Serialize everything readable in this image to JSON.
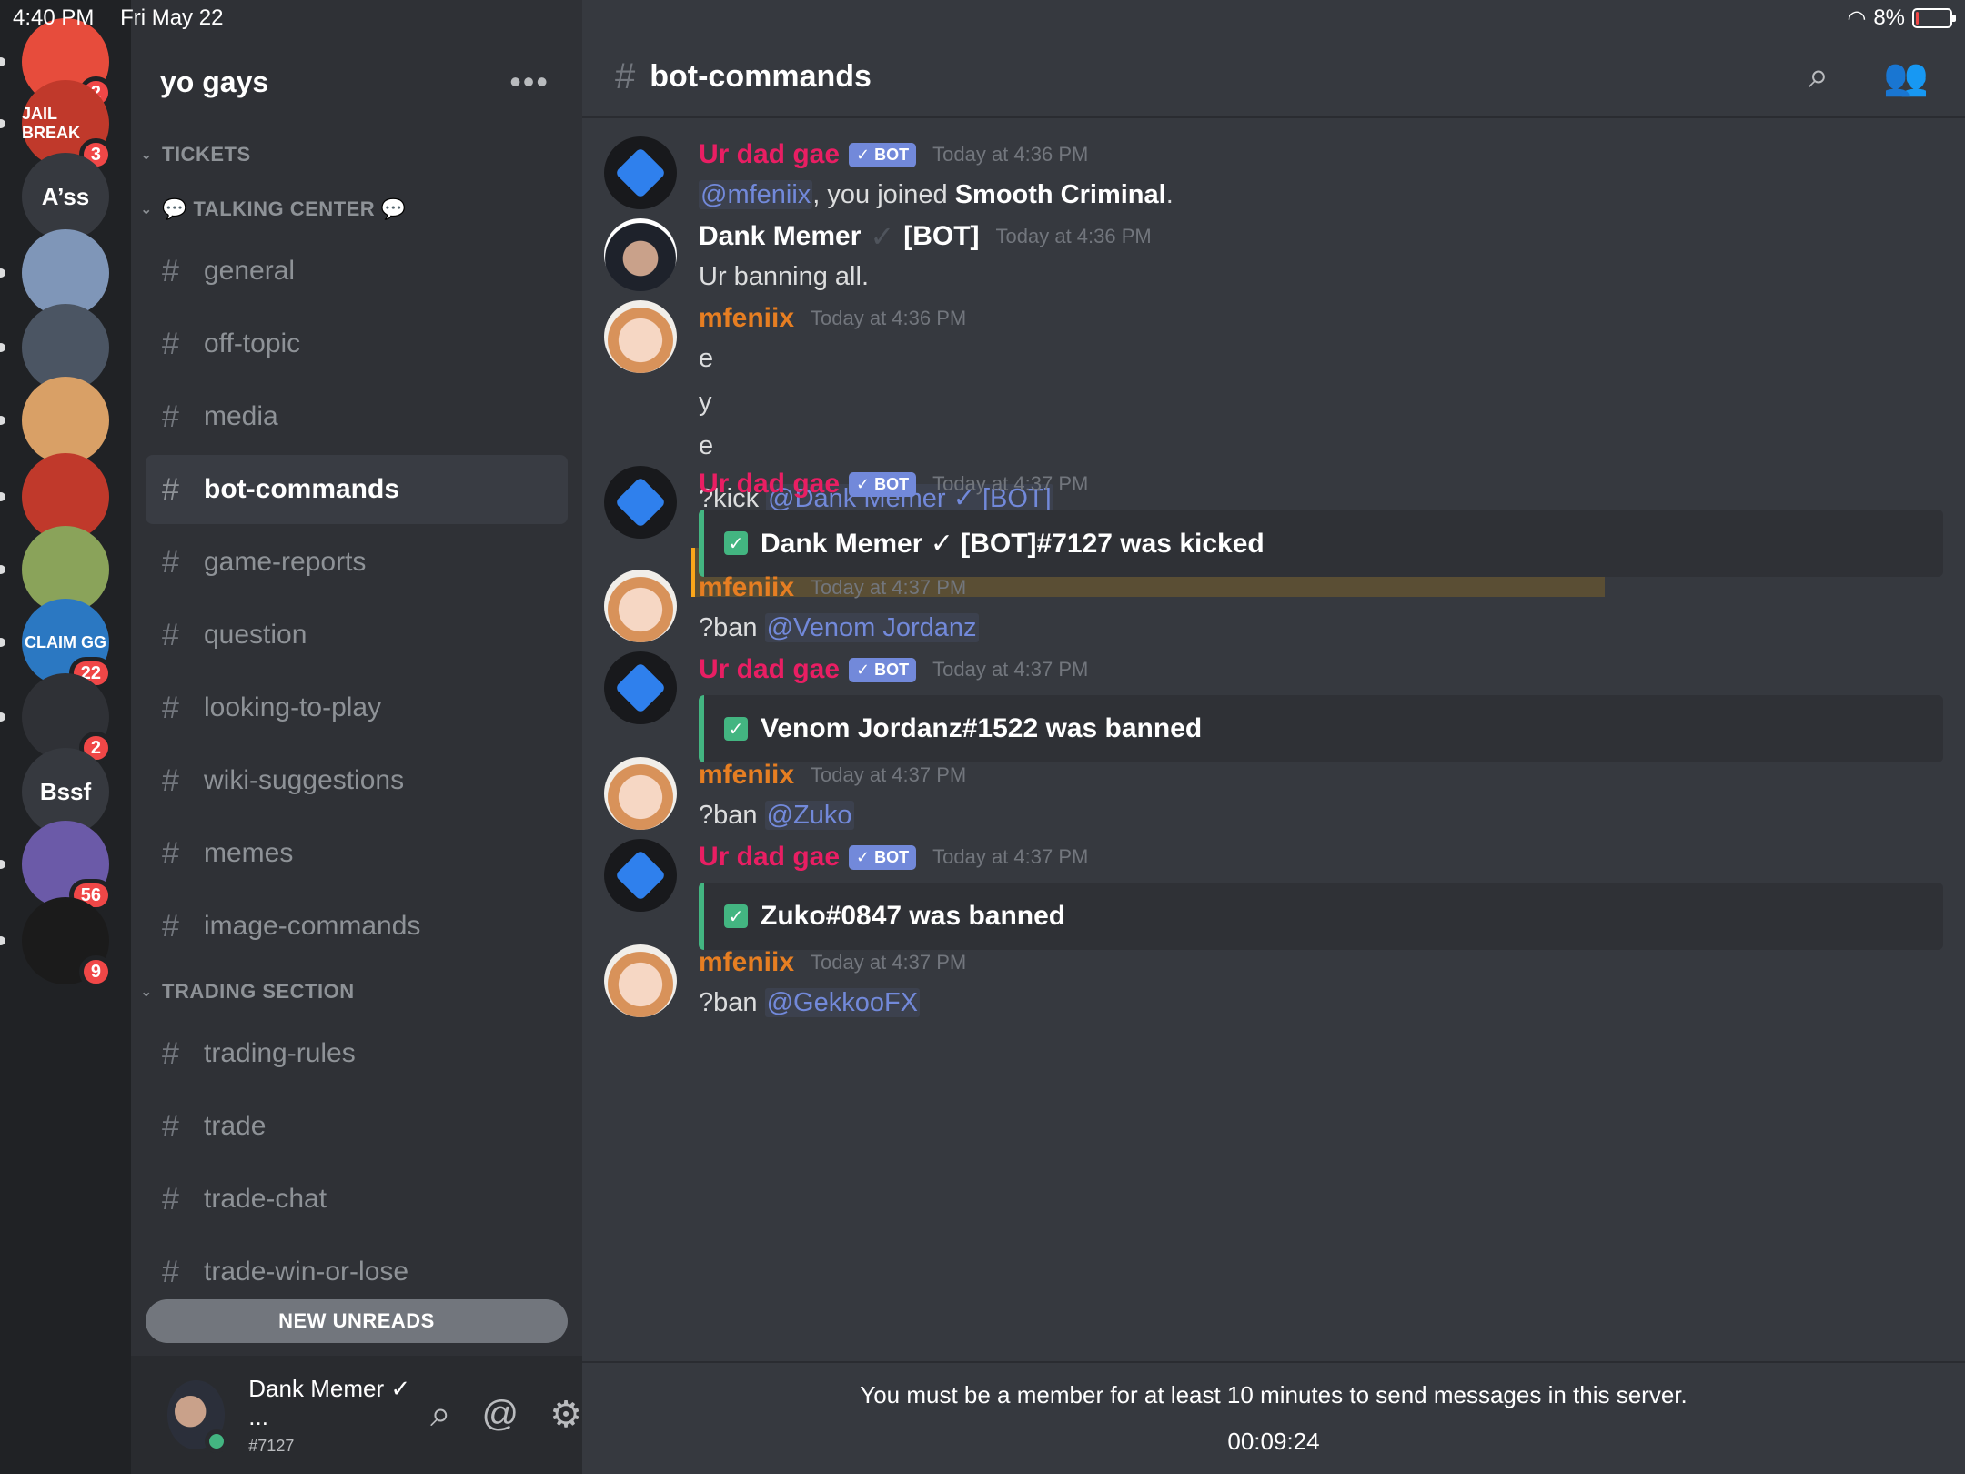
{
  "statusbar": {
    "time": "4:40 PM",
    "date": "Fri May 22",
    "battery": "8%",
    "battery_level": 0.08
  },
  "servers": [
    {
      "label": "",
      "badge": "2",
      "color": "#e74c3c"
    },
    {
      "label": "JAIL BREAK",
      "badge": "3",
      "color": "#c0392b"
    },
    {
      "label": "A’ss",
      "badge": "",
      "color": "#36393f"
    },
    {
      "label": "",
      "badge": "",
      "color": "#7f96b8"
    },
    {
      "label": "",
      "badge": "",
      "color": "#4b5563"
    },
    {
      "label": "",
      "badge": "",
      "color": "#d9a066"
    },
    {
      "label": "",
      "badge": "",
      "color": "#c0392b"
    },
    {
      "label": "",
      "badge": "",
      "color": "#8aa35a"
    },
    {
      "label": "CLAIM GG",
      "badge": "22",
      "color": "#2b78c2"
    },
    {
      "label": "",
      "badge": "2",
      "color": "#2f3136"
    },
    {
      "label": "Bssf",
      "badge": "",
      "color": "#36393f"
    },
    {
      "label": "",
      "badge": "56",
      "color": "#6b5aa8"
    },
    {
      "label": "",
      "badge": "9",
      "color": "#1b1b1b"
    }
  ],
  "sidebar": {
    "guild_name": "yo gays",
    "more": "•••",
    "categories": {
      "tickets": "TICKETS",
      "talking": "💬 TALKING CENTER 💬",
      "trading": "TRADING SECTION"
    },
    "talking_channels": [
      "general",
      "off-topic",
      "media",
      "bot-commands",
      "game-reports",
      "question",
      "looking-to-play",
      "wiki-suggestions",
      "memes",
      "image-commands"
    ],
    "trading_channels": [
      "trading-rules",
      "trade",
      "trade-chat",
      "trade-win-or-lose"
    ],
    "new_unreads": "NEW UNREADS",
    "user": {
      "name": "Dank Memer ✓ ...",
      "tag": "#7127"
    }
  },
  "chat": {
    "channel": "bot-commands",
    "messages": [
      {
        "author": "Ur dad gae",
        "bot": "✓ BOT",
        "time": "Today at 4:36 PM",
        "mention": "@mfeniix",
        "text1": ", you joined ",
        "bold": "Smooth Criminal",
        "text2": "."
      },
      {
        "author": "Dank Memer",
        "suffix": "[BOT]",
        "time": "Today at 4:36 PM",
        "text": "Ur banning all."
      },
      {
        "author": "mfeniix",
        "time": "Today at 4:36 PM",
        "lines": [
          "e",
          "y",
          "e"
        ],
        "cmd": "?kick ",
        "mention": "@Dank Memer ✓ [BOT]"
      },
      {
        "author": "Ur dad gae",
        "bot": "✓ BOT",
        "time": "Today at 4:37 PM",
        "embed": "Dank Memer ✓ [BOT]#7127 was kicked"
      },
      {
        "author": "mfeniix",
        "time": "Today at 4:37 PM",
        "cmd": "?ban ",
        "mention": "@Venom Jordanz"
      },
      {
        "author": "Ur dad gae",
        "bot": "✓ BOT",
        "time": "Today at 4:37 PM",
        "embed": "Venom Jordanz#1522 was banned"
      },
      {
        "author": "mfeniix",
        "time": "Today at 4:37 PM",
        "cmd": "?ban ",
        "mention": "@Zuko"
      },
      {
        "author": "Ur dad gae",
        "bot": "✓ BOT",
        "time": "Today at 4:37 PM",
        "embed": "Zuko#0847 was banned"
      },
      {
        "author": "mfeniix",
        "time": "Today at 4:37 PM",
        "cmd": "?ban ",
        "mention": "@GekkooFX"
      }
    ],
    "notice": "You must be a member for at least 10 minutes to send messages in this server.",
    "timer": "00:09:24"
  }
}
